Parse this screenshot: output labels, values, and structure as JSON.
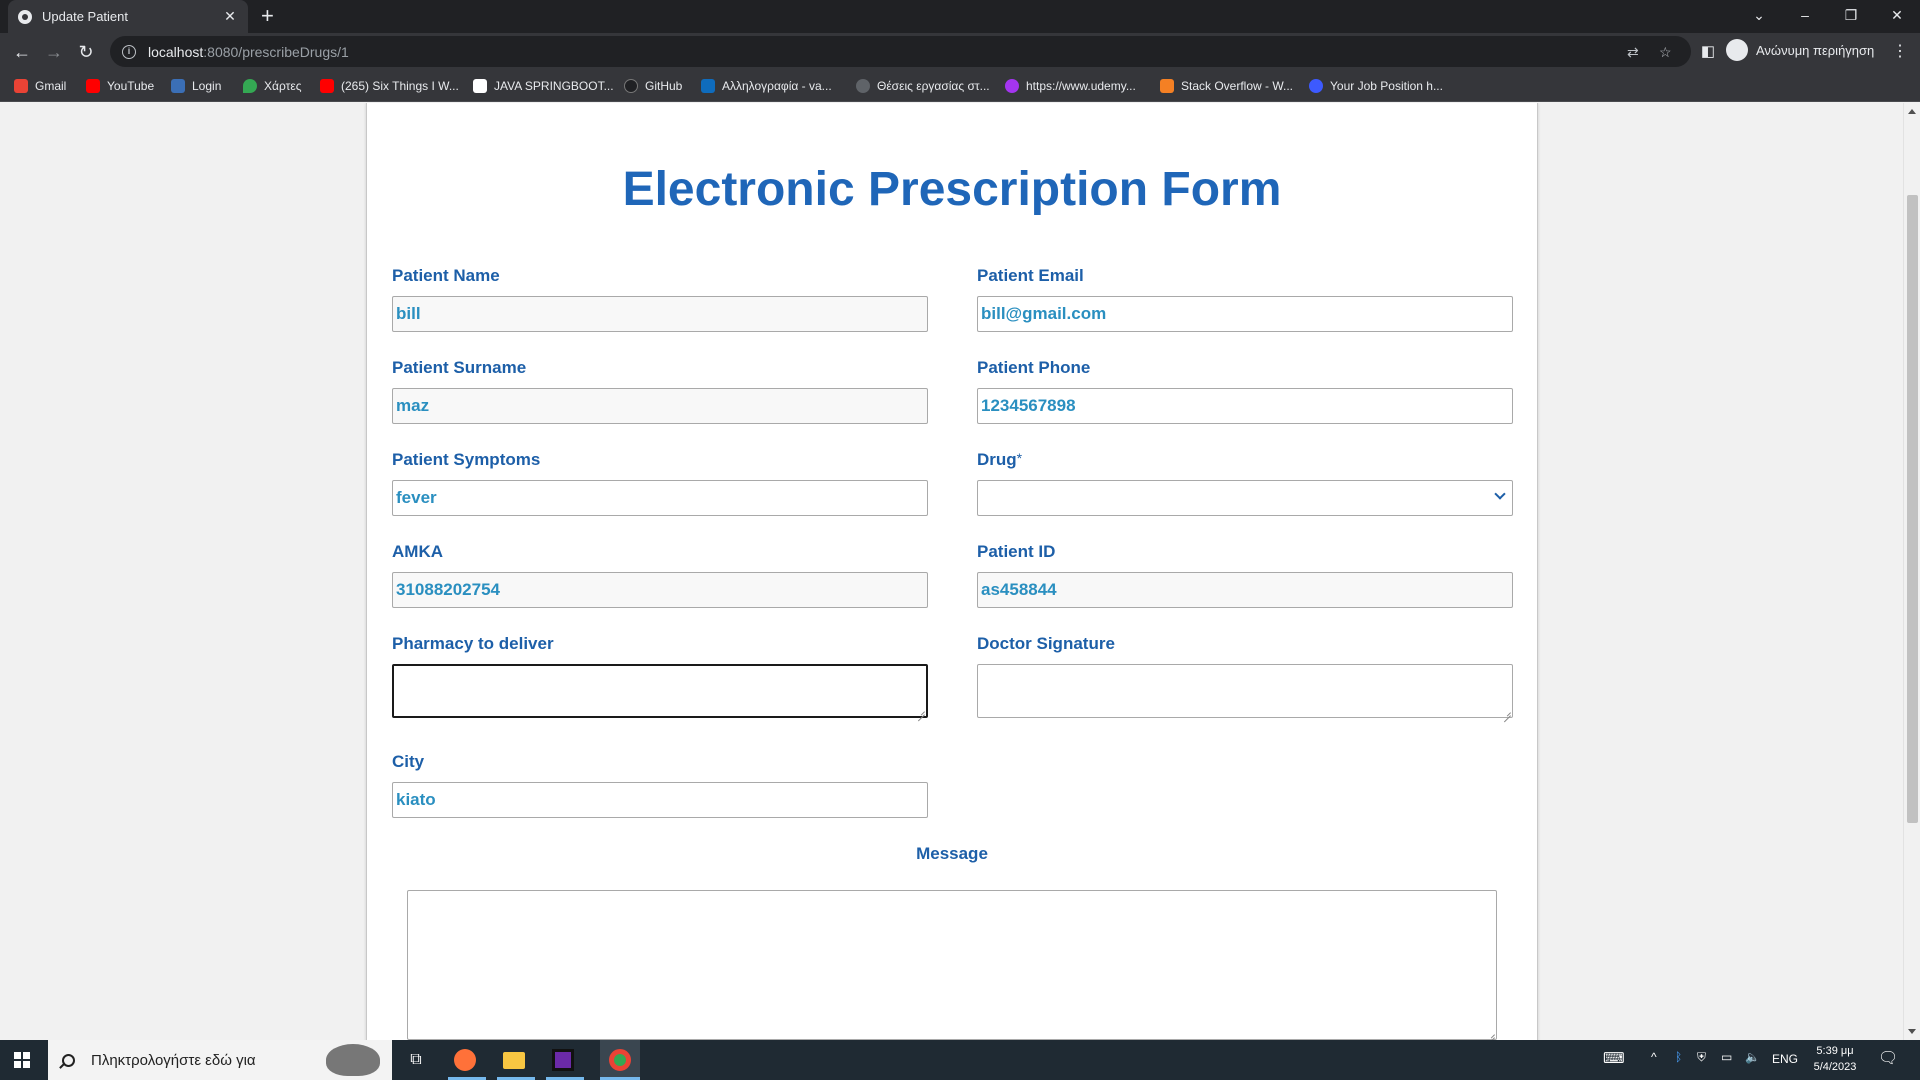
{
  "browser": {
    "tab_title": "Update Patient",
    "tab_close": "✕",
    "new_tab": "+",
    "url_host": "localhost",
    "url_rest": ":8080/prescribeDrugs/1",
    "profile_name": "Ανώνυμη περιήγηση",
    "bookmarks": [
      {
        "label": "Gmail",
        "color": "#ea4335"
      },
      {
        "label": "YouTube",
        "color": "#ff0000"
      },
      {
        "label": "Login",
        "color": "#3b6fb6"
      },
      {
        "label": "Χάρτες",
        "color": "#34a853"
      },
      {
        "label": "(265) Six Things I W...",
        "color": "#ff0000"
      },
      {
        "label": "JAVA SPRINGBOOT...",
        "color": "#ffffff"
      },
      {
        "label": "GitHub",
        "color": "#202124"
      },
      {
        "label": "Αλληλογραφία - va...",
        "color": "#0f6cbd"
      },
      {
        "label": "Θέσεις εργασίας στ...",
        "color": "#5f6368"
      },
      {
        "label": "https://www.udemy...",
        "color": "#a435f0"
      },
      {
        "label": "Stack Overflow - W...",
        "color": "#f48024"
      },
      {
        "label": "Your Job Position h...",
        "color": "#3d5afe"
      }
    ]
  },
  "form": {
    "title": "Electronic Prescription Form",
    "patient_name": {
      "label": "Patient Name",
      "value": "bill"
    },
    "patient_email": {
      "label": "Patient Email",
      "value": "bill@gmail.com"
    },
    "patient_surname": {
      "label": "Patient Surname",
      "value": "maz"
    },
    "patient_phone": {
      "label": "Patient Phone",
      "value": "1234567898"
    },
    "patient_symptoms": {
      "label": "Patient Symptoms",
      "value": "fever"
    },
    "drug": {
      "label": "Drug",
      "required_mark": "*",
      "value": ""
    },
    "amka": {
      "label": "AMKA",
      "value": "31088202754"
    },
    "patient_id": {
      "label": "Patient ID",
      "value": "as458844"
    },
    "pharmacy": {
      "label": "Pharmacy to deliver",
      "value": ""
    },
    "doctor_signature": {
      "label": "Doctor Signature",
      "value": ""
    },
    "city": {
      "label": "City",
      "value": "kiato"
    },
    "message": {
      "label": "Message",
      "value": ""
    }
  },
  "taskbar": {
    "search_placeholder": "Πληκτρολογήστε εδώ για",
    "language": "ENG",
    "time": "5:39 μμ",
    "date": "5/4/2023"
  },
  "colors": {
    "title_blue": "#1f66b8",
    "label_blue": "#1d5fa8",
    "value_cyan": "#2a8fc0"
  }
}
